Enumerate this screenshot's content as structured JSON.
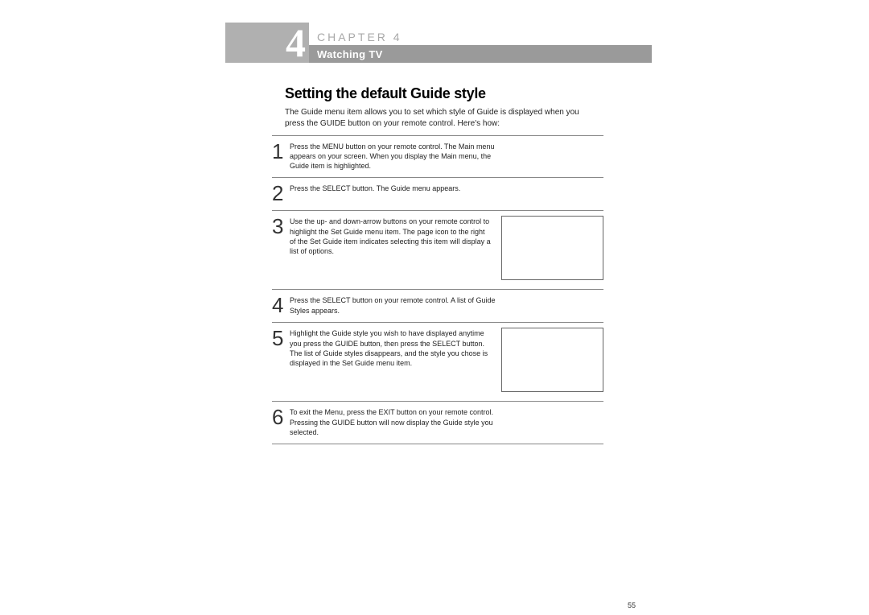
{
  "header": {
    "chapter_number": "4",
    "chapter_label": "CHAPTER 4",
    "chapter_subtitle": "Watching TV"
  },
  "section": {
    "title": "Setting the default Guide style",
    "intro": "The Guide menu item allows you to set which style of Guide is displayed when you press the GUIDE button on your remote control. Here's how:"
  },
  "steps": [
    {
      "num": "1",
      "text": "Press the MENU button on your remote control.\nThe Main menu appears on your screen.\nWhen you display the Main menu, the Guide item is highlighted.",
      "image": false
    },
    {
      "num": "2",
      "text": "Press the SELECT button.\nThe Guide menu appears.",
      "image": false
    },
    {
      "num": "3",
      "text": "Use the up- and down-arrow buttons on your remote control to highlight the Set Guide menu item. The page icon to the right of the Set Guide item indicates selecting this item will display a list of options.",
      "image": true
    },
    {
      "num": "4",
      "text": "Press the SELECT button on your remote control.\nA list of Guide Styles appears.",
      "image": false
    },
    {
      "num": "5",
      "text": "Highlight the Guide style you wish to have displayed anytime you press the GUIDE button, then press the SELECT button.\nThe list of Guide styles disappears, and the style you chose is displayed in the Set Guide menu item.",
      "image": true
    },
    {
      "num": "6",
      "text": "To exit the Menu, press the EXIT button on your remote control.\nPressing the GUIDE button will now display the Guide style you selected.",
      "image": false
    }
  ],
  "page_number": "55"
}
